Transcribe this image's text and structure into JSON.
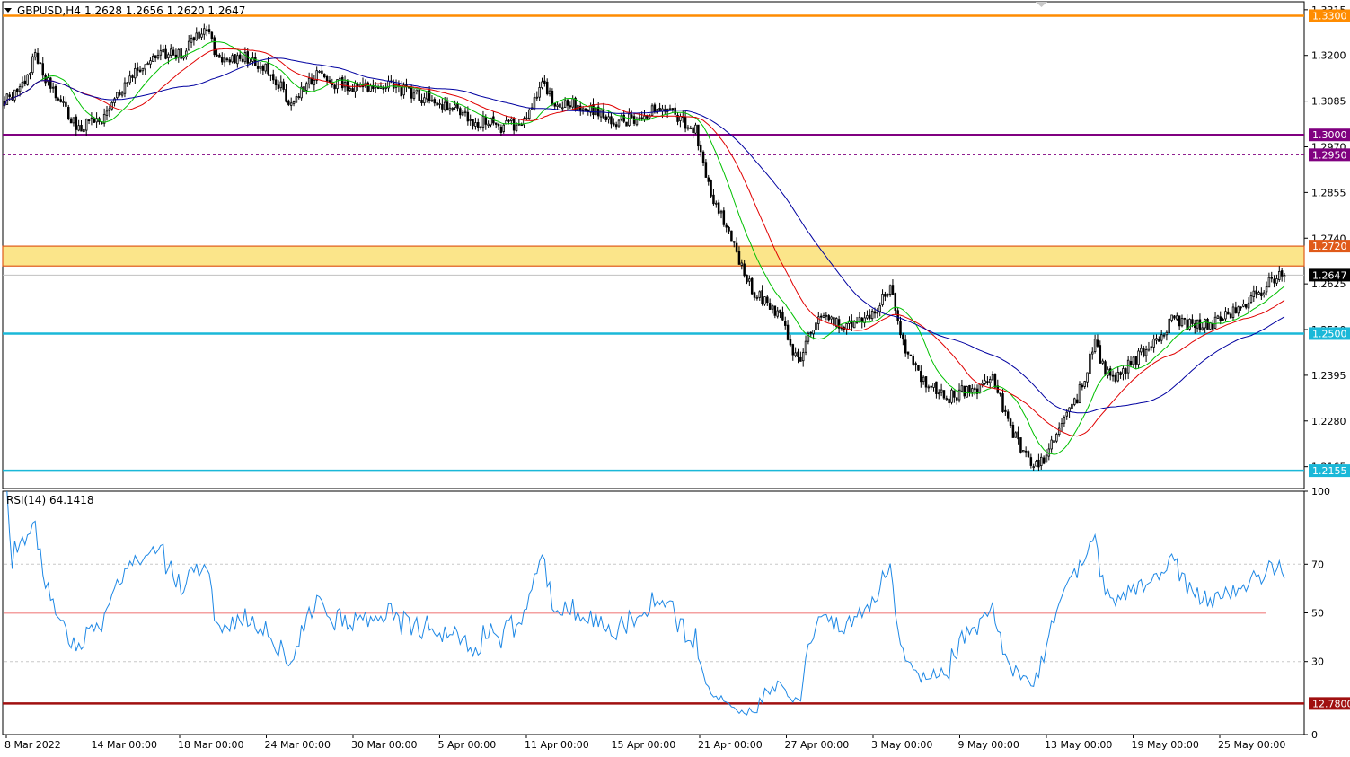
{
  "header": {
    "symbol": "GBPUSD,H4",
    "ohlc": "1.2628 1.2656 1.2620 1.2647"
  },
  "rsi_header": "RSI(14) 64.1418",
  "colors": {
    "background": "#ffffff",
    "candles": "#000000",
    "ma_fast": "#00c000",
    "ma_mid": "#e00000",
    "ma_slow": "#0000a0",
    "resistance_orange": "#ff8c00",
    "level_purple": "#800080",
    "zone_fill": "#fbe58a",
    "zone_border": "#e05a1a",
    "level_cyan": "#1ab8d8",
    "rsi_line": "#1e88e5",
    "rsi_50": "#f4a0a0",
    "rsi_level_dark_red": "#a01010"
  },
  "chart_data": [
    {
      "type": "candlestick",
      "title": "GBPUSD,H4",
      "ylim": [
        1.211,
        1.3335
      ],
      "y_ticks": [
        "1.3315",
        "1.3200",
        "1.3085",
        "1.2970",
        "1.2855",
        "1.2740",
        "1.2625",
        "1.2510",
        "1.2395",
        "1.2280",
        "1.2165"
      ],
      "x_ticks": [
        "8 Mar 2022",
        "14 Mar 00:00",
        "18 Mar 00:00",
        "24 Mar 00:00",
        "30 Mar 00:00",
        "5 Apr 00:00",
        "11 Apr 00:00",
        "15 Apr 00:00",
        "21 Apr 00:00",
        "27 Apr 00:00",
        "3 May 00:00",
        "9 May 00:00",
        "13 May 00:00",
        "19 May 00:00",
        "25 May 00:00"
      ],
      "current_price": 1.2647,
      "price_path": [
        [
          0,
          1.309
        ],
        [
          6,
          1.311
        ],
        [
          12,
          1.32
        ],
        [
          18,
          1.312
        ],
        [
          28,
          1.302
        ],
        [
          40,
          1.305
        ],
        [
          50,
          1.316
        ],
        [
          62,
          1.32
        ],
        [
          70,
          1.321
        ],
        [
          76,
          1.325
        ],
        [
          78,
          1.328
        ],
        [
          84,
          1.318
        ],
        [
          94,
          1.32
        ],
        [
          104,
          1.316
        ],
        [
          112,
          1.308
        ],
        [
          122,
          1.315
        ],
        [
          134,
          1.312
        ],
        [
          146,
          1.313
        ],
        [
          158,
          1.311
        ],
        [
          170,
          1.308
        ],
        [
          182,
          1.304
        ],
        [
          194,
          1.302
        ],
        [
          204,
          1.303
        ],
        [
          210,
          1.314
        ],
        [
          214,
          1.309
        ],
        [
          226,
          1.307
        ],
        [
          240,
          1.303
        ],
        [
          252,
          1.306
        ],
        [
          262,
          1.305
        ],
        [
          270,
          1.301
        ],
        [
          276,
          1.286
        ],
        [
          284,
          1.273
        ],
        [
          292,
          1.261
        ],
        [
          302,
          1.255
        ],
        [
          310,
          1.243
        ],
        [
          318,
          1.255
        ],
        [
          330,
          1.252
        ],
        [
          340,
          1.255
        ],
        [
          346,
          1.262
        ],
        [
          350,
          1.249
        ],
        [
          358,
          1.238
        ],
        [
          368,
          1.234
        ],
        [
          378,
          1.236
        ],
        [
          386,
          1.238
        ],
        [
          396,
          1.222
        ],
        [
          404,
          1.216
        ],
        [
          410,
          1.224
        ],
        [
          418,
          1.232
        ],
        [
          426,
          1.247
        ],
        [
          432,
          1.238
        ],
        [
          444,
          1.245
        ],
        [
          456,
          1.253
        ],
        [
          470,
          1.252
        ],
        [
          478,
          1.255
        ],
        [
          486,
          1.258
        ],
        [
          494,
          1.263
        ],
        [
          500,
          1.2647
        ]
      ],
      "levels": [
        {
          "price": 1.33,
          "label": "1.3300",
          "color": "#ff8c00",
          "style": "solid"
        },
        {
          "price": 1.3,
          "label": "1.3000",
          "color": "#800080",
          "style": "solid"
        },
        {
          "price": 1.295,
          "label": "1.2950",
          "color": "#800080",
          "style": "dashed"
        },
        {
          "price": 1.272,
          "label": "1.2720",
          "color": "#e05a1a",
          "style": "zone_top"
        },
        {
          "price": 1.25,
          "label": "1.2500",
          "color": "#1ab8d8",
          "style": "solid"
        },
        {
          "price": 1.2155,
          "label": "1.2155",
          "color": "#1ab8d8",
          "style": "solid"
        }
      ],
      "zone": {
        "from": 1.267,
        "to": 1.272
      },
      "moving_averages": [
        {
          "color": "#00c000",
          "period": 5
        },
        {
          "color": "#e00000",
          "period": 10
        },
        {
          "color": "#0000a0",
          "period": 20
        }
      ]
    },
    {
      "type": "line",
      "title": "RSI(14) 64.1418",
      "ylim": [
        0,
        100
      ],
      "y_ticks": [
        "100",
        "70",
        "50",
        "30",
        "0"
      ],
      "levels": [
        {
          "value": 50,
          "color": "#f4a0a0"
        },
        {
          "value": 12.78,
          "label": "12.7800",
          "color": "#a01010"
        }
      ],
      "last_value": 64.1418
    }
  ]
}
